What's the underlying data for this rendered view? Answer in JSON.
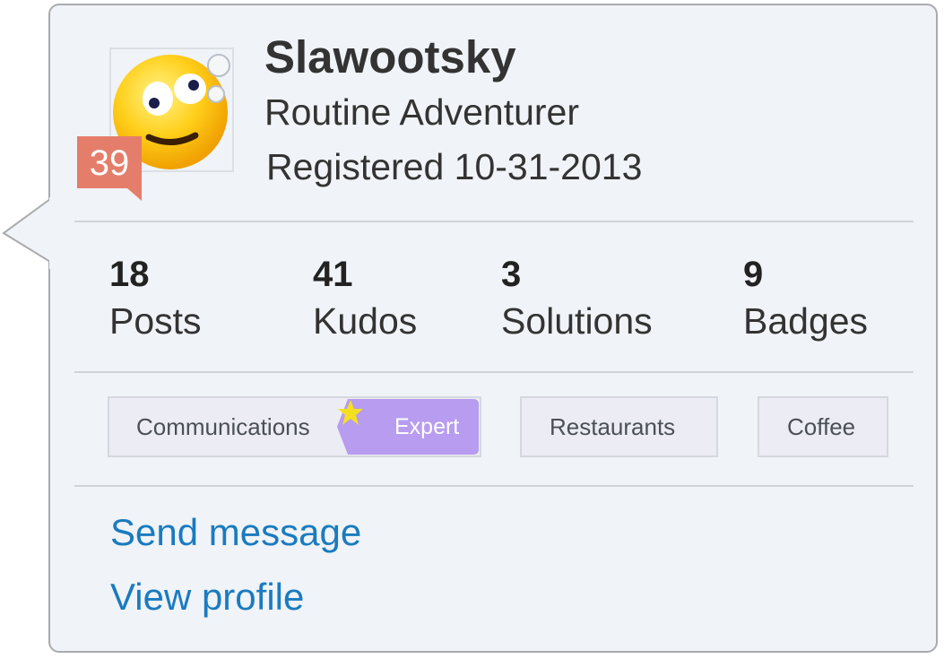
{
  "profile": {
    "username": "Slawootsky",
    "rank_title": "Routine Adventurer",
    "registered": "Registered 10-31-2013",
    "rank_number": "39",
    "avatar_icon": "dizzy-smiley-icon"
  },
  "stats": [
    {
      "value": "18",
      "label": "Posts"
    },
    {
      "value": "41",
      "label": "Kudos"
    },
    {
      "value": "3",
      "label": "Solutions"
    },
    {
      "value": "9",
      "label": "Badges"
    }
  ],
  "tags": [
    {
      "label": "Communications",
      "badge": "Expert"
    },
    {
      "label": "Restaurants"
    },
    {
      "label": "Coffee"
    }
  ],
  "actions": {
    "send_message": "Send message",
    "view_profile": "View profile"
  },
  "colors": {
    "card_background": "#f0f3f7",
    "rank_badge": "#e57d6b",
    "expert_badge": "#b79cf0",
    "link": "#1a7bbf",
    "star": "#f5e020"
  }
}
